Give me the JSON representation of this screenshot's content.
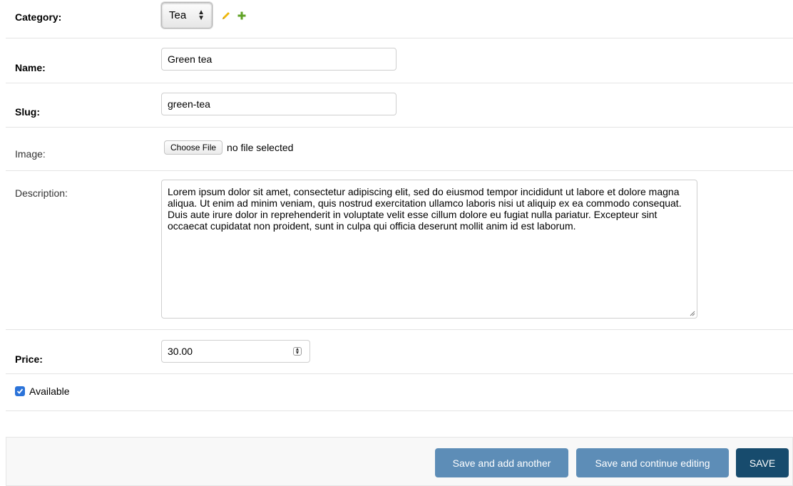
{
  "fields": {
    "category": {
      "label": "Category:",
      "selected": "Tea"
    },
    "name": {
      "label": "Name:",
      "value": "Green tea"
    },
    "slug": {
      "label": "Slug:",
      "value": "green-tea"
    },
    "image": {
      "label": "Image:",
      "button_label": "Choose File",
      "status": "no file selected"
    },
    "description": {
      "label": "Description:",
      "value": "Lorem ipsum dolor sit amet, consectetur adipiscing elit, sed do eiusmod tempor incididunt ut labore et dolore magna aliqua. Ut enim ad minim veniam, quis nostrud exercitation ullamco laboris nisi ut aliquip ex ea commodo consequat. Duis aute irure dolor in reprehenderit in voluptate velit esse cillum dolore eu fugiat nulla pariatur. Excepteur sint occaecat cupidatat non proident, sunt in culpa qui officia deserunt mollit anim id est laborum."
    },
    "price": {
      "label": "Price:",
      "value": "30.00"
    },
    "available": {
      "label": "Available",
      "checked": true
    }
  },
  "icons": {
    "edit": "pencil-icon",
    "add": "plus-icon",
    "edit_color": "#efb80b",
    "add_color": "#5fa225"
  },
  "buttons": {
    "save_add_another": "Save and add another",
    "save_continue": "Save and continue editing",
    "save": "SAVE"
  },
  "colors": {
    "button_light": "#5d8db7",
    "button_dark": "#174b6d",
    "checkbox": "#2b73d9"
  }
}
